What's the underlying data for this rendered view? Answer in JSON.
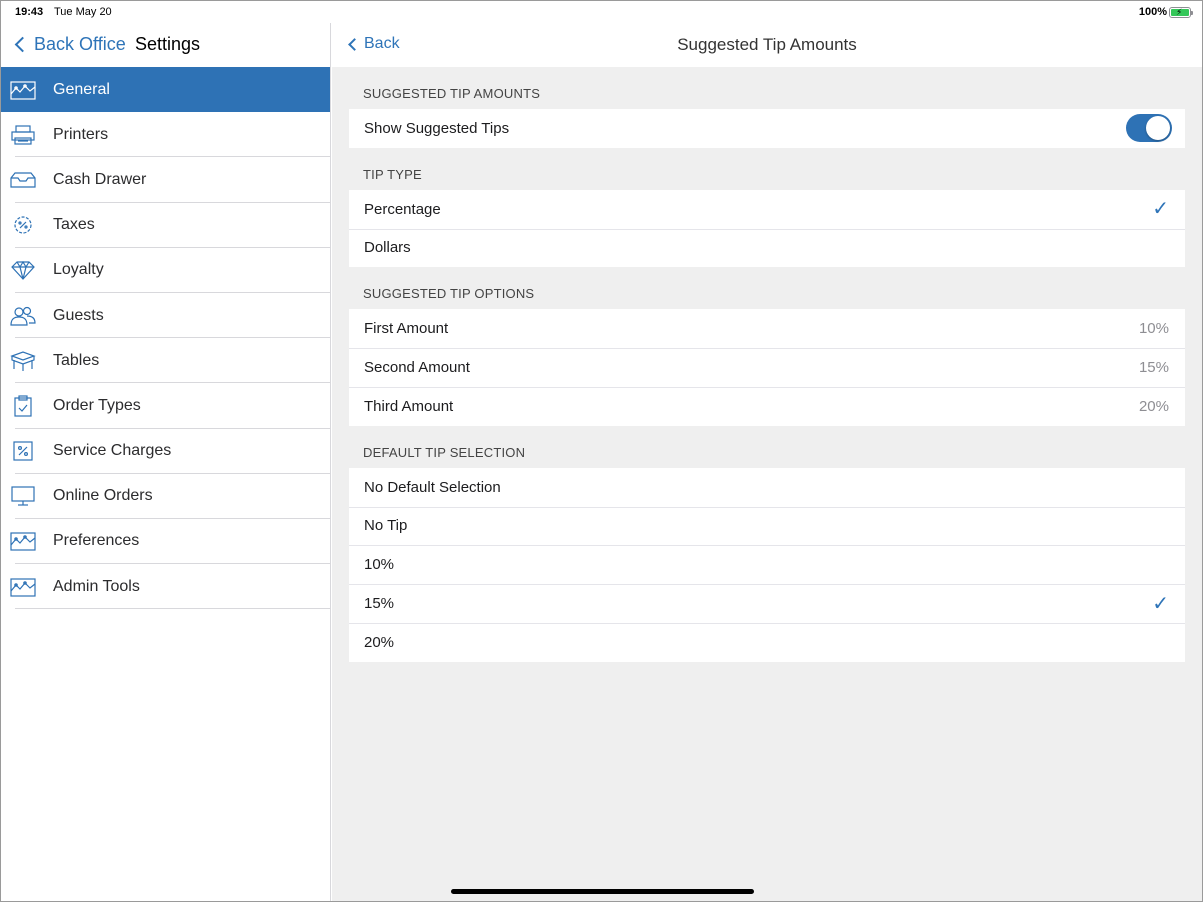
{
  "status_bar": {
    "time": "19:43",
    "date": "Tue May 20",
    "battery": "100%"
  },
  "sidebar": {
    "back_label": "Back Office",
    "title": "Settings",
    "items": [
      {
        "label": "General",
        "icon": "general-icon",
        "active": true
      },
      {
        "label": "Printers",
        "icon": "printer-icon"
      },
      {
        "label": "Cash Drawer",
        "icon": "cash-drawer-icon"
      },
      {
        "label": "Taxes",
        "icon": "tax-icon"
      },
      {
        "label": "Loyalty",
        "icon": "diamond-icon"
      },
      {
        "label": "Guests",
        "icon": "guests-icon"
      },
      {
        "label": "Tables",
        "icon": "table-icon"
      },
      {
        "label": "Order Types",
        "icon": "clipboard-icon"
      },
      {
        "label": "Service Charges",
        "icon": "percent-icon"
      },
      {
        "label": "Online Orders",
        "icon": "monitor-icon"
      },
      {
        "label": "Preferences",
        "icon": "preferences-icon"
      },
      {
        "label": "Admin Tools",
        "icon": "admin-tools-icon"
      }
    ]
  },
  "nav": {
    "back_label": "Back",
    "title": "Suggested Tip Amounts"
  },
  "sections": {
    "suggested": {
      "header": "SUGGESTED TIP AMOUNTS",
      "show_label": "Show Suggested Tips",
      "show_enabled": true
    },
    "tip_type": {
      "header": "TIP TYPE",
      "options": [
        "Percentage",
        "Dollars"
      ],
      "selected": "Percentage"
    },
    "tip_options": {
      "header": "SUGGESTED TIP OPTIONS",
      "rows": [
        {
          "label": "First Amount",
          "value": "10%"
        },
        {
          "label": "Second Amount",
          "value": "15%"
        },
        {
          "label": "Third Amount",
          "value": "20%"
        }
      ]
    },
    "default_selection": {
      "header": "DEFAULT TIP SELECTION",
      "options": [
        "No Default Selection",
        "No Tip",
        "10%",
        "15%",
        "20%"
      ],
      "selected": "15%"
    }
  },
  "colors": {
    "accent": "#2e72b5",
    "link": "#2e74b8",
    "background": "#efefef"
  }
}
